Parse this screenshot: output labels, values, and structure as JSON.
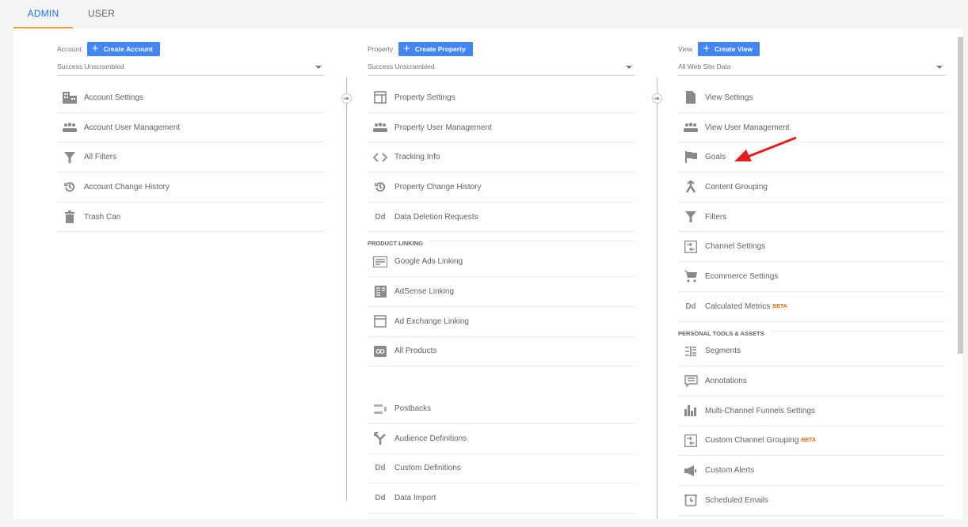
{
  "tabs": [
    {
      "label": "ADMIN",
      "active": true
    },
    {
      "label": "USER",
      "active": false
    }
  ],
  "colors": {
    "accent": "#1a73e8",
    "tab_indicator": "#e6a23c",
    "button": "#4285f4",
    "beta": "#e8710a",
    "annotation_arrow": "#e02020"
  },
  "account": {
    "label": "Account",
    "create_label": "Create Account",
    "selected": "Success Unscrambled",
    "items": [
      {
        "label": "Account Settings",
        "icon": "building-icon"
      },
      {
        "label": "Account User Management",
        "icon": "users-icon"
      },
      {
        "label": "All Filters",
        "icon": "filter-icon"
      },
      {
        "label": "Account Change History",
        "icon": "history-icon"
      },
      {
        "label": "Trash Can",
        "icon": "trash-icon"
      }
    ]
  },
  "property": {
    "label": "Property",
    "create_label": "Create Property",
    "selected": "Success Unscrambled",
    "items": [
      {
        "label": "Property Settings",
        "icon": "window-icon"
      },
      {
        "label": "Property User Management",
        "icon": "users-icon"
      },
      {
        "label": "Tracking Info",
        "icon": "code-icon"
      },
      {
        "label": "Property Change History",
        "icon": "history-icon"
      },
      {
        "label": "Data Deletion Requests",
        "icon": "dd-icon"
      }
    ],
    "section_label": "PRODUCT LINKING",
    "linking_items": [
      {
        "label": "Google Ads Linking",
        "icon": "ads-icon"
      },
      {
        "label": "AdSense Linking",
        "icon": "adsense-icon"
      },
      {
        "label": "Ad Exchange Linking",
        "icon": "window-icon"
      },
      {
        "label": "All Products",
        "icon": "link-icon"
      }
    ],
    "more_items": [
      {
        "label": "Postbacks",
        "icon": "postbacks-icon"
      },
      {
        "label": "Audience Definitions",
        "icon": "fork-icon"
      },
      {
        "label": "Custom Definitions",
        "icon": "dd-icon"
      },
      {
        "label": "Data Import",
        "icon": "dd-icon"
      }
    ]
  },
  "view": {
    "label": "View",
    "create_label": "Create View",
    "selected": "All Web Site Data",
    "items": [
      {
        "label": "View Settings",
        "icon": "document-icon"
      },
      {
        "label": "View User Management",
        "icon": "users-icon"
      },
      {
        "label": "Goals",
        "icon": "flag-icon"
      },
      {
        "label": "Content Grouping",
        "icon": "merge-icon"
      },
      {
        "label": "Filters",
        "icon": "filter-icon"
      },
      {
        "label": "Channel Settings",
        "icon": "channel-icon"
      },
      {
        "label": "Ecommerce Settings",
        "icon": "cart-icon"
      },
      {
        "label": "Calculated Metrics",
        "icon": "dd-icon",
        "badge": "BETA"
      }
    ],
    "section_label": "PERSONAL TOOLS & ASSETS",
    "personal_items": [
      {
        "label": "Segments",
        "icon": "segments-icon"
      },
      {
        "label": "Annotations",
        "icon": "comment-icon"
      },
      {
        "label": "Multi-Channel Funnels Settings",
        "icon": "bar-chart-icon"
      },
      {
        "label": "Custom Channel Grouping",
        "icon": "channel-icon",
        "badge": "BETA"
      },
      {
        "label": "Custom Alerts",
        "icon": "megaphone-icon"
      },
      {
        "label": "Scheduled Emails",
        "icon": "alarm-icon"
      }
    ]
  }
}
